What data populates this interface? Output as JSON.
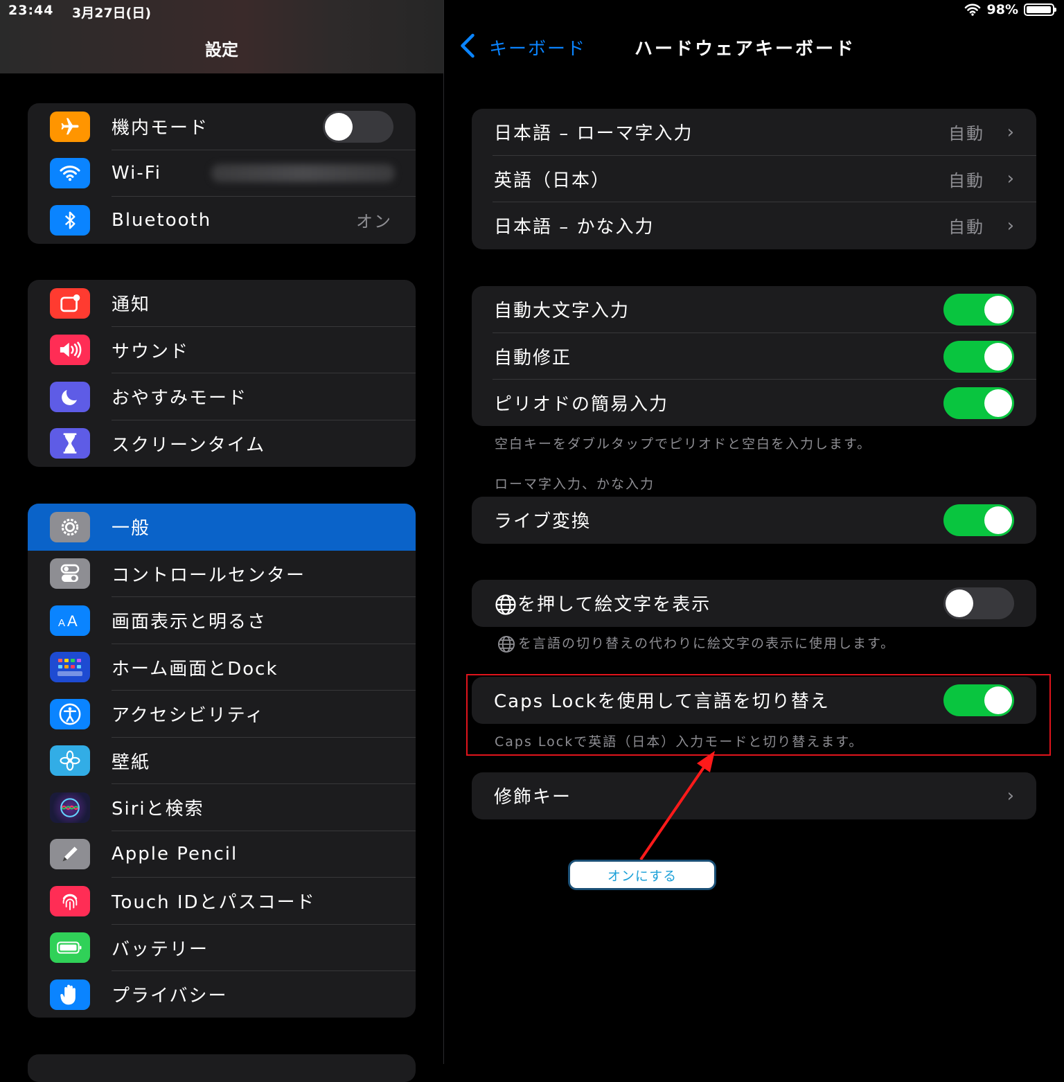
{
  "status": {
    "time": "23:44",
    "date": "3月27日(日)",
    "battery_pct": "98%",
    "battery_level": 0.98
  },
  "sidebar": {
    "title": "設定",
    "group1": [
      {
        "label": "機内モード",
        "icon": "airplane-icon",
        "color": "#ff9500",
        "toggle": "off"
      },
      {
        "label": "Wi-Fi",
        "icon": "wifi-icon",
        "color": "#0a84ff",
        "value_blurred": true
      },
      {
        "label": "Bluetooth",
        "icon": "bluetooth-icon",
        "color": "#0a84ff",
        "value": "オン"
      }
    ],
    "group2": [
      {
        "label": "通知",
        "icon": "notifications-icon",
        "color": "#ff3b30"
      },
      {
        "label": "サウンド",
        "icon": "sound-icon",
        "color": "#ff2d55"
      },
      {
        "label": "おやすみモード",
        "icon": "moon-icon",
        "color": "#5e5ce6"
      },
      {
        "label": "スクリーンタイム",
        "icon": "hourglass-icon",
        "color": "#5e5ce6"
      }
    ],
    "group3": [
      {
        "label": "一般",
        "icon": "gear-icon",
        "color": "#8e8e93",
        "selected": true
      },
      {
        "label": "コントロールセンター",
        "icon": "control-center-icon",
        "color": "#8e8e93"
      },
      {
        "label": "画面表示と明るさ",
        "icon": "display-icon",
        "color": "#0a84ff"
      },
      {
        "label": "ホーム画面とDock",
        "icon": "home-screen-icon",
        "color": "#1e4bd2"
      },
      {
        "label": "アクセシビリティ",
        "icon": "accessibility-icon",
        "color": "#0a84ff"
      },
      {
        "label": "壁紙",
        "icon": "wallpaper-icon",
        "color": "#32ade6"
      },
      {
        "label": "Siriと検索",
        "icon": "siri-icon",
        "color": "#222"
      },
      {
        "label": "Apple Pencil",
        "icon": "pencil-icon",
        "color": "#8e8e93"
      },
      {
        "label": "Touch IDとパスコード",
        "icon": "fingerprint-icon",
        "color": "#ff2d55"
      },
      {
        "label": "バッテリー",
        "icon": "battery-icon",
        "color": "#30d158"
      },
      {
        "label": "プライバシー",
        "icon": "hand-icon",
        "color": "#0a84ff"
      }
    ]
  },
  "detail": {
    "back_label": "キーボード",
    "title": "ハードウェアキーボード",
    "layouts": [
      {
        "label": "日本語 – ローマ字入力",
        "value": "自動"
      },
      {
        "label": "英語（日本）",
        "value": "自動"
      },
      {
        "label": "日本語 – かな入力",
        "value": "自動"
      }
    ],
    "auto_options": [
      {
        "label": "自動大文字入力",
        "toggle": "on"
      },
      {
        "label": "自動修正",
        "toggle": "on"
      },
      {
        "label": "ピリオドの簡易入力",
        "toggle": "on"
      }
    ],
    "period_footer": "空白キーをダブルタップでピリオドと空白を入力します。",
    "kana_header": "ローマ字入力、かな入力",
    "live_conversion": {
      "label": "ライブ変換",
      "toggle": "on"
    },
    "globe_emoji": {
      "label": "を押して絵文字を表示",
      "toggle": "off",
      "footer": "を言語の切り替えの代わりに絵文字の表示に使用します。"
    },
    "caps_lock": {
      "label": "Caps Lockを使用して言語を切り替え",
      "toggle": "on",
      "footer": "Caps Lockで英語（日本）入力モードと切り替えます。"
    },
    "modifier_keys": {
      "label": "修飾キー"
    }
  },
  "annotation": {
    "callout_text": "オンにする",
    "highlight_color": "#e0141c"
  }
}
